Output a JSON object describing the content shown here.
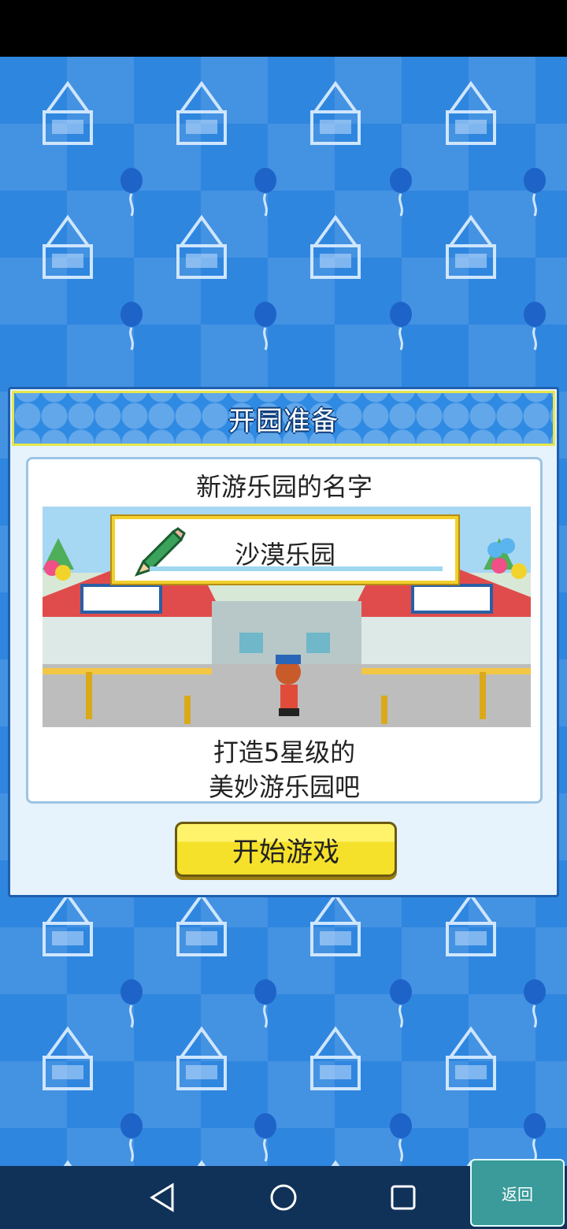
{
  "dialog": {
    "title": "开园准备",
    "section_label": "新游乐园的名字",
    "park_name": "沙漠乐园",
    "caption_line1": "打造5星级的",
    "caption_line2": "美妙游乐园吧",
    "start_button": "开始游戏"
  },
  "nav": {
    "back_label": "返回"
  },
  "colors": {
    "background": "#2f86df",
    "dialog_border": "#1d5fae",
    "header_border": "#e7e64b",
    "button_yellow": "#f5e12a"
  },
  "icons": {
    "pencil": "pencil-icon",
    "nav_back": "triangle-back-icon",
    "nav_home": "circle-home-icon",
    "nav_recent": "square-recent-icon"
  }
}
